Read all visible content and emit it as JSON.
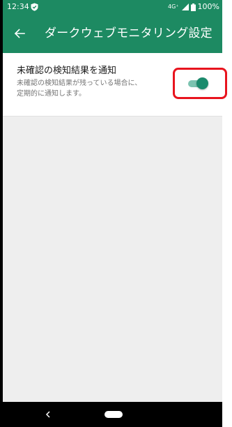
{
  "status_bar": {
    "time": "12:34",
    "network": "4G⁺",
    "battery": "100%"
  },
  "app_bar": {
    "title": "ダークウェブモニタリング設定"
  },
  "setting": {
    "title": "未確認の検知結果を通知",
    "description_lines": [
      "未確認の検知結果が残っている場合に、",
      "定期的に通知します。"
    ],
    "toggle_on": true
  },
  "colors": {
    "primary": "#1d8a62",
    "toggle_thumb": "#1b8a6c",
    "toggle_track": "#7cc3b0",
    "background": "#eeeeee",
    "highlight": "#e8141e"
  },
  "icons": {
    "status_shield": "shield-check-icon",
    "back": "arrow-left-icon",
    "signal": "signal-icon",
    "battery": "battery-icon",
    "nav_back": "chevron-left-icon",
    "nav_home": "home-pill-icon"
  }
}
